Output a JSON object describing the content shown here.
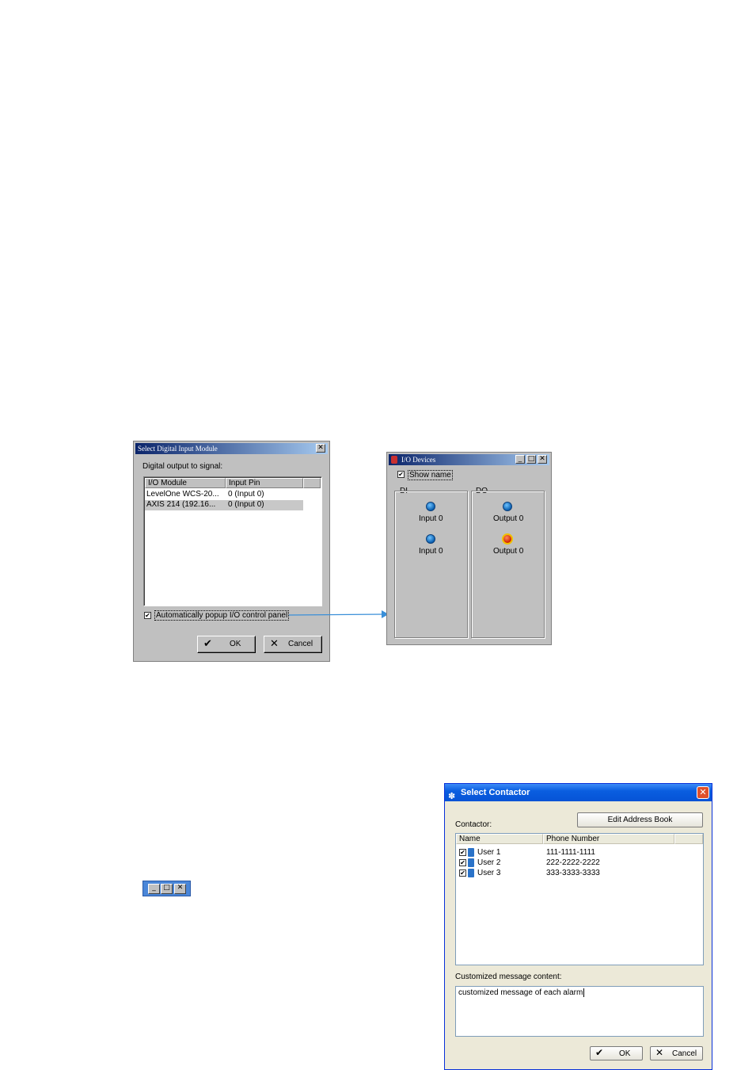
{
  "dialog1": {
    "title": "Select Digital Input Module",
    "close": "✕",
    "prompt": "Digital output to signal:",
    "columns": [
      "I/O Module",
      "Input Pin"
    ],
    "rows": [
      {
        "module": "LevelOne WCS-20...",
        "pin": "0 (Input 0)"
      },
      {
        "module": "AXIS 214 (192.16...",
        "pin": "0 (Input 0)"
      }
    ],
    "auto_popup_label": "Automatically popup I/O control panel",
    "ok_label": "OK",
    "cancel_label": "Cancel"
  },
  "io_devices": {
    "title": "I/O Devices",
    "show_name_label": "Show name",
    "di_label": "DI",
    "do_label": "DO",
    "di_items": [
      "Input 0",
      "Input 0"
    ],
    "do_items": [
      "Output 0",
      "Output 0"
    ]
  },
  "window_controls_sample": {
    "min": "_",
    "max": "□",
    "close": "✕"
  },
  "dialog2": {
    "title": "Select Contactor",
    "contactor_label": "Contactor:",
    "edit_address_book": "Edit Address Book",
    "columns": [
      "Name",
      "Phone Number"
    ],
    "contacts": [
      {
        "name": "User 1",
        "phone": "111-1111-1111"
      },
      {
        "name": "User 2",
        "phone": "222-2222-2222"
      },
      {
        "name": "User 3",
        "phone": "333-3333-3333"
      }
    ],
    "message_label": "Customized message content:",
    "message_value": "customized message of each alarm",
    "ok_label": "OK",
    "cancel_label": "Cancel"
  },
  "colors": {
    "arrow": "#3a8fd8",
    "xp_title": "#0a5ee0",
    "win98_title": "#0a246a"
  }
}
